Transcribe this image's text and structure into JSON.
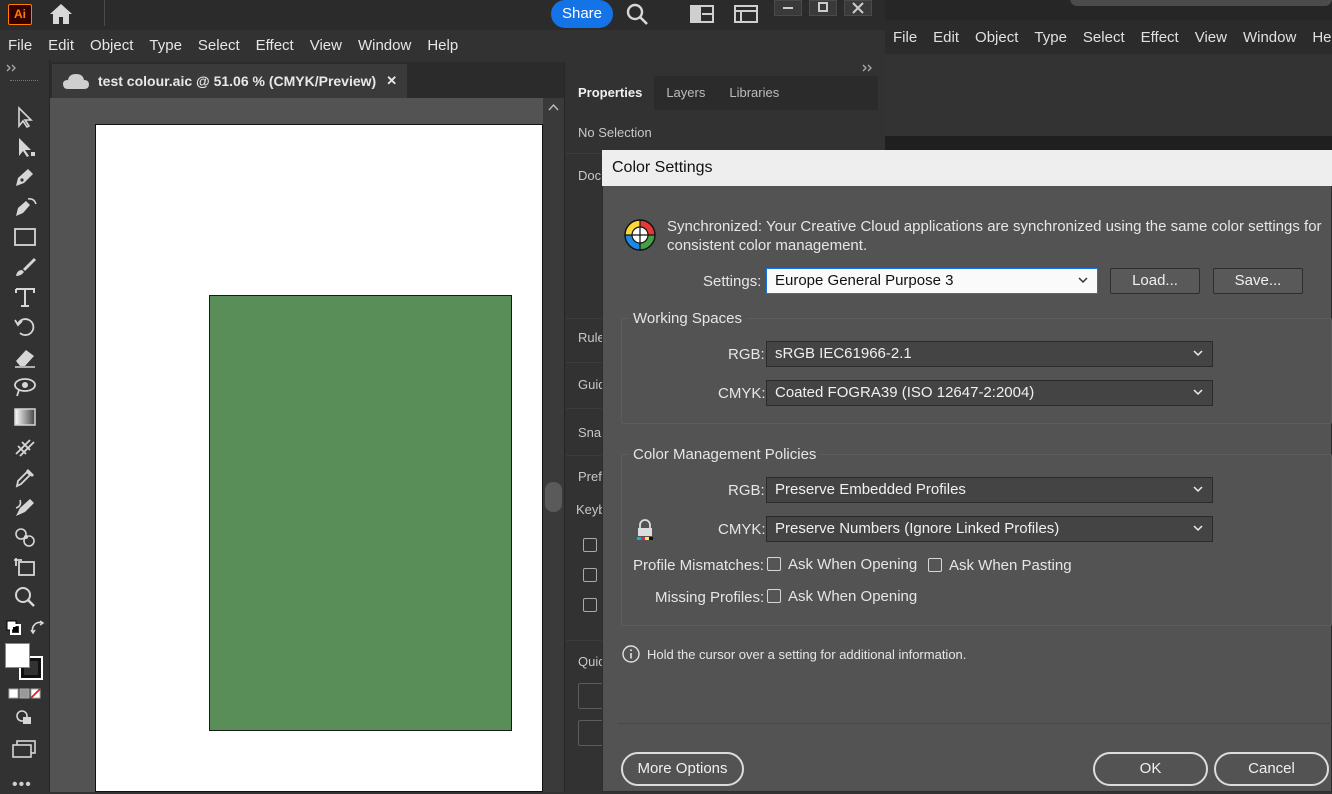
{
  "app": {
    "logo_text": "Ai",
    "share_label": "Share"
  },
  "menu": [
    "File",
    "Edit",
    "Object",
    "Type",
    "Select",
    "Effect",
    "View",
    "Window",
    "Help"
  ],
  "bg_menu": [
    "File",
    "Edit",
    "Object",
    "Type",
    "Select",
    "Effect",
    "View",
    "Window",
    "He"
  ],
  "document": {
    "tab_title": "test colour.aic @ 51.06 % (CMYK/Preview)",
    "close_glyph": "✕"
  },
  "properties": {
    "tabs": [
      "Properties",
      "Layers",
      "Libraries"
    ],
    "no_selection": "No Selection",
    "partial_labels": [
      "Doc",
      "Rule",
      "Guid",
      "Snap",
      "Prefi",
      "Keyb",
      "Quic"
    ]
  },
  "dialog": {
    "title": "Color Settings",
    "sync_text": "Synchronized: Your Creative Cloud applications are synchronized using the same color settings for consistent color management.",
    "settings_label": "Settings:",
    "settings_value": "Europe General Purpose 3",
    "load_label": "Load...",
    "save_label": "Save...",
    "working_spaces": {
      "title": "Working Spaces",
      "rgb_label": "RGB:",
      "rgb_value": "sRGB IEC61966-2.1",
      "cmyk_label": "CMYK:",
      "cmyk_value": "Coated FOGRA39 (ISO 12647-2:2004)"
    },
    "policies": {
      "title": "Color Management Policies",
      "rgb_label": "RGB:",
      "rgb_value": "Preserve Embedded Profiles",
      "cmyk_label": "CMYK:",
      "cmyk_value": "Preserve Numbers (Ignore Linked Profiles)",
      "mismatch_label": "Profile Mismatches:",
      "ask_opening": "Ask When Opening",
      "ask_pasting": "Ask When Pasting",
      "missing_label": "Missing Profiles:",
      "missing_ask_opening": "Ask When Opening"
    },
    "info_text": "Hold the cursor over a setting for additional information.",
    "more_options": "More Options",
    "ok": "OK",
    "cancel": "Cancel"
  },
  "colors": {
    "artwork_fill": "#5a8e58",
    "accent": "#1473e6",
    "ai_orange": "#ff7c00"
  }
}
